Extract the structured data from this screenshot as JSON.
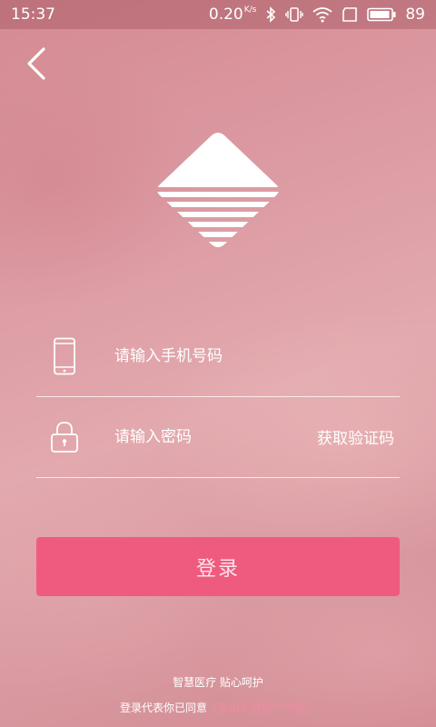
{
  "status_bar": {
    "time": "15:37",
    "network_speed": "0.20",
    "network_speed_unit": "K/s",
    "battery_level": "89",
    "icons": [
      "bluetooth-icon",
      "vibrate-icon",
      "wifi-icon",
      "sim-icon",
      "battery-icon"
    ]
  },
  "header": {
    "back_icon": "chevron-left-icon"
  },
  "logo": {
    "icon": "striped-diamond-logo"
  },
  "form": {
    "phone": {
      "icon": "phone-icon",
      "placeholder": "请输入手机号码"
    },
    "password": {
      "icon": "lock-icon",
      "placeholder": "请输入密码",
      "get_code_label": "获取验证码"
    }
  },
  "login_button": {
    "label": "登录",
    "color": "#ef5b7e"
  },
  "footer": {
    "slogan": "智慧医疗 贴心呵护",
    "agreement_prefix": "登录代表你已同意",
    "agreement_link": "《南山乳舒用户协议》",
    "link_color": "#f08aa2"
  }
}
